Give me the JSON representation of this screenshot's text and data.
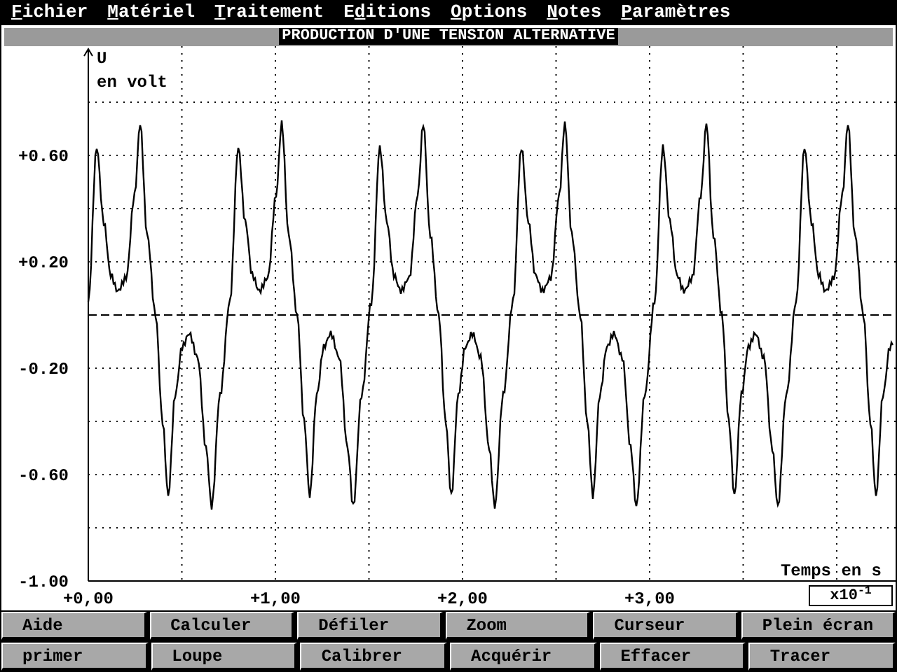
{
  "menu": [
    {
      "key": "F",
      "after": "ichier"
    },
    {
      "key": "M",
      "after": "atériel"
    },
    {
      "key": "T",
      "after": "raitement"
    },
    {
      "before": "E",
      "key": "d",
      "after": "itions"
    },
    {
      "key": "O",
      "after": "ptions"
    },
    {
      "key": "N",
      "after": "otes"
    },
    {
      "key": "P",
      "after": "aramètres"
    }
  ],
  "window": {
    "title": "PRODUCTION D'UNE TENSION ALTERNATIVE"
  },
  "plot": {
    "y_axis_label": "U",
    "y_unit": "en volt",
    "x_axis_label": "Temps en s",
    "y_ticks": [
      "+0.60",
      "+0.20",
      "-0.20",
      "-0.60",
      "-1.00"
    ],
    "x_ticks": [
      "+0,00",
      "+1,00",
      "+2,00",
      "+3,00"
    ],
    "x_scale": "x10$^{-1}$"
  },
  "buttons": [
    [
      "Aide",
      "Calculer",
      "Défiler",
      "Zoom",
      "Curseur",
      "Plein écran"
    ],
    [
      "primer",
      "Loupe",
      "Calibrer",
      "Acquérir",
      "Effacer",
      "Tracer"
    ]
  ]
}
